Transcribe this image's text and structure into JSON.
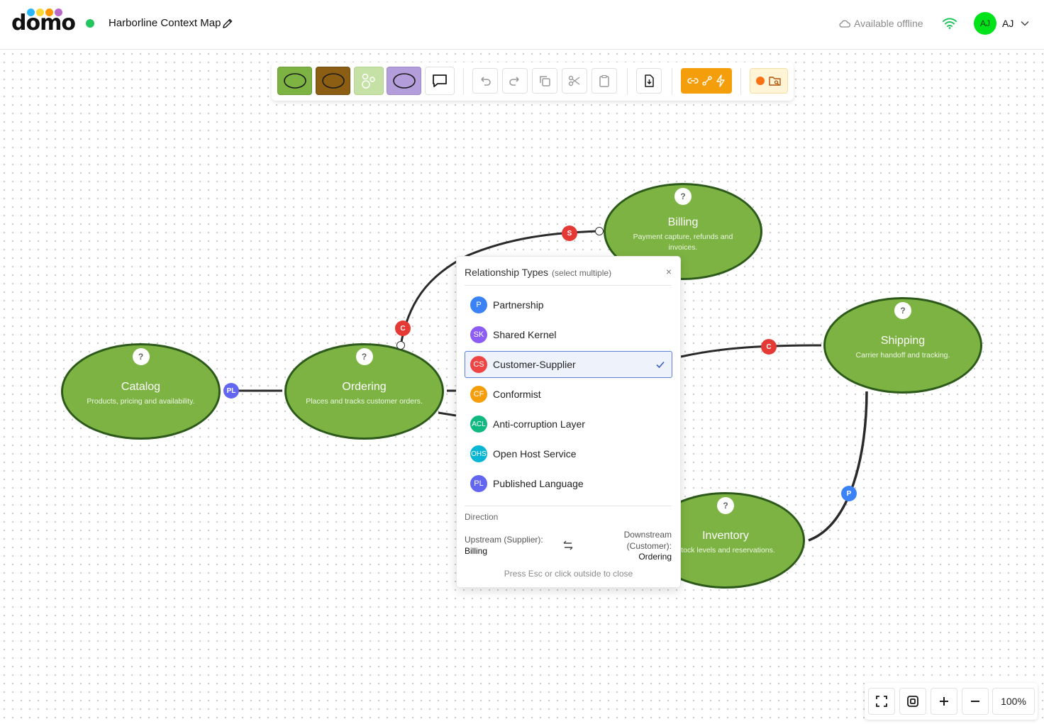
{
  "app": {
    "logo_text": "domo",
    "logo_dot_colors": [
      "#29b6f6",
      "#fdd835",
      "#ff9800",
      "#ba68c8"
    ],
    "doc_title": "Harborline Context Map",
    "offline_label": "Available offline",
    "user_initials": "AJ",
    "user_name": "AJ",
    "status_color": "#22c55e"
  },
  "toolbar": {
    "tools": [
      {
        "name": "bounded-context-green",
        "icon": "ellipse-icon",
        "fill": "#7cb342"
      },
      {
        "name": "bounded-context-brown",
        "icon": "ellipse-icon",
        "fill": "#8b5e14"
      },
      {
        "name": "aggregate-cluster",
        "icon": "circles-icon",
        "fill": "#c5e1a5"
      },
      {
        "name": "external-system",
        "icon": "ellipse-icon",
        "fill": "#b39ddb"
      },
      {
        "name": "comment",
        "icon": "speech-bubble-icon",
        "fill": "#ffffff"
      }
    ],
    "actions": [
      "undo-icon",
      "redo-icon",
      "copy-icon",
      "cut-icon",
      "paste-icon",
      "export-icon"
    ],
    "relationship_tool_color": "#f59e0b"
  },
  "nodes": [
    {
      "id": "billing",
      "title": "Billing",
      "description": "Payment capture, refunds and invoices.",
      "help": "?"
    },
    {
      "id": "shipping",
      "title": "Shipping",
      "description": "Carrier handoff and tracking.",
      "help": "?"
    },
    {
      "id": "catalog",
      "title": "Catalog",
      "description": "Products, pricing and availability.",
      "help": "?"
    },
    {
      "id": "ordering",
      "title": "Ordering",
      "description": "Places and tracks customer orders.",
      "help": "?"
    },
    {
      "id": "inventory",
      "title": "Inventory",
      "description": "Stock levels and reservations.",
      "help": "?"
    }
  ],
  "badges": [
    {
      "label": "S",
      "color": "#e53935"
    },
    {
      "label": "C",
      "color": "#e53935"
    },
    {
      "label": "C",
      "color": "#e53935"
    },
    {
      "label": "PL",
      "color": "#6366f1"
    },
    {
      "label": "P",
      "color": "#3b82f6"
    }
  ],
  "popover": {
    "title": "Relationship Types",
    "subtitle": "(select multiple)",
    "close": "×",
    "items": [
      {
        "abbr": "P",
        "label": "Partnership",
        "color": "#3b82f6",
        "selected": false
      },
      {
        "abbr": "SK",
        "label": "Shared Kernel",
        "color": "#8b5cf6",
        "selected": false
      },
      {
        "abbr": "CS",
        "label": "Customer-Supplier",
        "color": "#ef4444",
        "selected": true
      },
      {
        "abbr": "CF",
        "label": "Conformist",
        "color": "#f59e0b",
        "selected": false
      },
      {
        "abbr": "ACL",
        "label": "Anti-corruption Layer",
        "color": "#10b981",
        "selected": false
      },
      {
        "abbr": "OHS",
        "label": "Open Host Service",
        "color": "#06b6d4",
        "selected": false
      },
      {
        "abbr": "PL",
        "label": "Published Language",
        "color": "#6366f1",
        "selected": false
      }
    ],
    "direction_label": "Direction",
    "upstream_label": "Upstream (Supplier):",
    "upstream_value": "Billing",
    "downstream_label": "Downstream (Customer):",
    "downstream_value": "Ordering",
    "hint": "Press Esc or click outside to close"
  },
  "zoom": {
    "level": "100%"
  }
}
